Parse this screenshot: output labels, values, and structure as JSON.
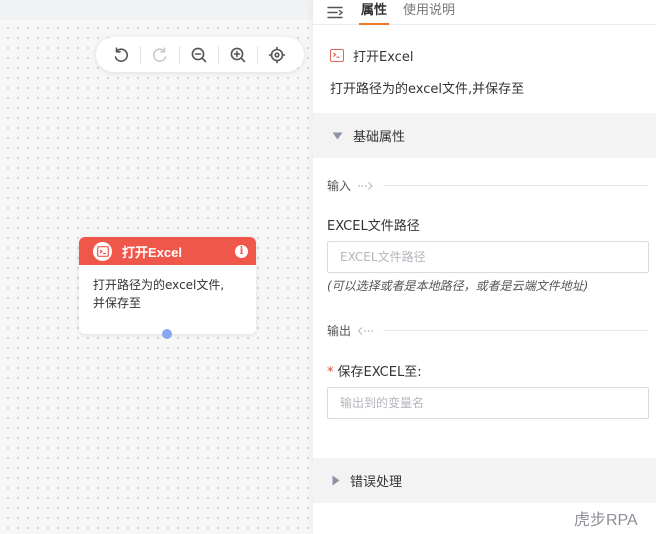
{
  "canvas": {
    "toolbar": {
      "undo_icon": "undo-icon",
      "redo_icon": "redo-icon",
      "zoom_out_icon": "zoom-out-icon",
      "zoom_in_icon": "zoom-in-icon",
      "locate_icon": "target-icon"
    },
    "node": {
      "title": "打开Excel",
      "desc_line1": "打开路径为的excel文件,",
      "desc_line2": "并保存至",
      "header_color": "#f0574b"
    }
  },
  "panel": {
    "tabs": [
      {
        "label": "属性",
        "active": true
      },
      {
        "label": "使用说明",
        "active": false
      }
    ],
    "command_name": "打开Excel",
    "command_desc": "打开路径为的excel文件,并保存至",
    "sections": {
      "basic": "基础属性",
      "error": "错误处理"
    },
    "input_divider": "输入",
    "output_divider": "输出",
    "fields": {
      "path_label": "EXCEL文件路径",
      "path_placeholder": "EXCEL文件路径",
      "path_hint": "(可以选择或者是本地路径，或者是云端文件地址)",
      "save_required": "*",
      "save_label": "保存EXCEL至:",
      "save_placeholder": "输出到的变量名"
    },
    "accent_color": "#e8772c"
  },
  "watermark": "虎步RPA"
}
